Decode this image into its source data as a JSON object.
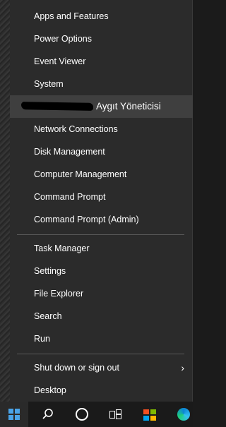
{
  "menu": {
    "items_top": [
      {
        "label": "Apps and Features"
      },
      {
        "label": "Power Options"
      },
      {
        "label": "Event Viewer"
      },
      {
        "label": "System"
      },
      {
        "label": "Aygıt Yöneticisi"
      },
      {
        "label": "Network Connections"
      },
      {
        "label": "Disk Management"
      },
      {
        "label": "Computer Management"
      },
      {
        "label": "Command Prompt"
      },
      {
        "label": "Command Prompt (Admin)"
      }
    ],
    "items_middle": [
      {
        "label": "Task Manager"
      },
      {
        "label": "Settings"
      },
      {
        "label": "File Explorer"
      },
      {
        "label": "Search"
      },
      {
        "label": "Run"
      }
    ],
    "items_bottom": [
      {
        "label": "Shut down or sign out",
        "chevron": "›"
      },
      {
        "label": "Desktop"
      }
    ]
  },
  "taskbar": {
    "icons": [
      "windows-start-icon",
      "search-icon",
      "cortana-icon",
      "task-view-icon",
      "store-icon",
      "edge-icon"
    ]
  },
  "colors": {
    "menu_bg": "#2b2b2b",
    "hover_bg": "#3f3f3f",
    "text": "#ffffff",
    "accent": "#4aa3e8"
  }
}
